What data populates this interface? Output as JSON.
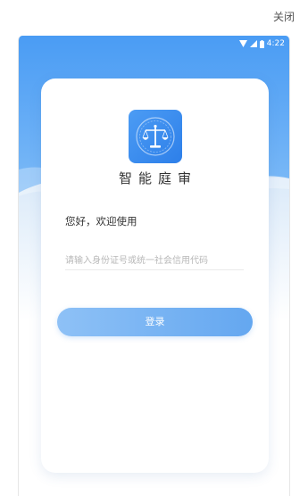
{
  "top_bar": {
    "close_label": "关闭"
  },
  "status_bar": {
    "time": "4:22",
    "icons": [
      "wifi-icon",
      "signal-icon",
      "battery-icon"
    ]
  },
  "app": {
    "name": "智能庭审",
    "logo_icon": "scales-of-justice-icon"
  },
  "login": {
    "greeting": "您好，欢迎使用",
    "id_input": {
      "placeholder": "请输入身份证号或统一社会信用代码",
      "value": ""
    },
    "submit_label": "登录"
  },
  "colors": {
    "header_blue": "#4a9cf4",
    "logo_blue": "#3a8cf0",
    "button_start": "#8ec1f6",
    "button_end": "#64a7f0",
    "text_primary": "#333333",
    "placeholder": "#b8b8b8"
  }
}
